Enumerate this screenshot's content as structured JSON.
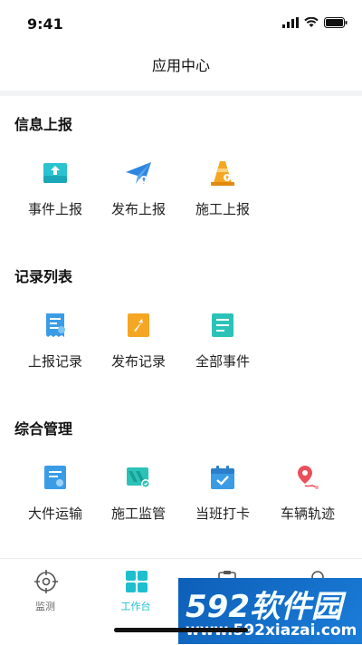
{
  "status_bar": {
    "time": "9:41"
  },
  "header": {
    "title": "应用中心"
  },
  "sections": [
    {
      "title": "信息上报",
      "items": [
        {
          "label": "事件上报",
          "icon": "upload-tray-icon"
        },
        {
          "label": "发布上报",
          "icon": "paper-plane-icon"
        },
        {
          "label": "施工上报",
          "icon": "traffic-cone-icon"
        }
      ]
    },
    {
      "title": "记录列表",
      "items": [
        {
          "label": "上报记录",
          "icon": "receipt-icon"
        },
        {
          "label": "发布记录",
          "icon": "publish-document-icon"
        },
        {
          "label": "全部事件",
          "icon": "list-document-icon"
        }
      ]
    },
    {
      "title": "综合管理",
      "items": [
        {
          "label": "大件运输",
          "icon": "transport-document-icon"
        },
        {
          "label": "施工监管",
          "icon": "construction-monitor-icon"
        },
        {
          "label": "当班打卡",
          "icon": "calendar-check-icon"
        },
        {
          "label": "车辆轨迹",
          "icon": "route-pin-icon"
        }
      ]
    }
  ],
  "tab_bar": {
    "tabs": [
      {
        "label": "监测",
        "icon": "target-icon"
      },
      {
        "label": "工作台",
        "icon": "grid-icon",
        "active": true
      },
      {
        "label": "",
        "icon": "clipboard-icon"
      },
      {
        "label": "",
        "icon": "person-icon"
      }
    ]
  },
  "watermark": {
    "logo": "592软件园",
    "url": "www.592xiazai.com"
  },
  "colors": {
    "accent": "#1dbfcf",
    "blue": "#2e86de",
    "orange": "#f5a623",
    "red": "#e8505b"
  }
}
